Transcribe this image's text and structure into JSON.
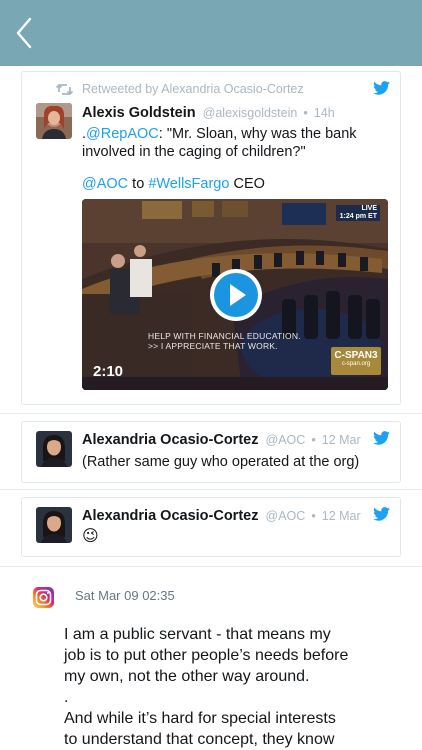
{
  "topbar": {
    "back_label": "back"
  },
  "tweet1": {
    "retweet_text": "Retweeted by Alexandria Ocasio-Cortez",
    "name": "Alexis Goldstein",
    "handle": "@alexisgoldstein",
    "time": "14h",
    "line1_prefix": ".",
    "line1_mention": "@RepAOC",
    "line1_rest": ": \"Mr. Sloan, why was the bank",
    "line2": "involved in the caging of children?\"",
    "line3_mention": "@AOC",
    "line3_mid": " to ",
    "line3_hashtag": "#WellsFargo",
    "line3_rest": " CEO",
    "video": {
      "duration": "2:10",
      "caption_line1": "HELP WITH FINANCIAL EDUCATION.",
      "caption_line2": ">> I APPRECIATE THAT WORK.",
      "live_line1": "LIVE",
      "live_line2": "1:24 pm ET",
      "network": "C-SPAN3",
      "network_url": "c-span.org"
    }
  },
  "tweet2": {
    "name": "Alexandria Ocasio-Cortez",
    "handle": "@AOC",
    "time": "12 Mar",
    "text": "(Rather same guy who operated at the org)"
  },
  "tweet3": {
    "name": "Alexandria Ocasio-Cortez",
    "handle": "@AOC",
    "time": "12 Mar",
    "text": "😉"
  },
  "instagram": {
    "date": "Sat Mar 09 02:35",
    "text_lines": [
      "I am a public servant - that means my",
      "job is to put other people’s needs before",
      "my own, not the other way around.",
      ".",
      "And while it’s hard for special interests",
      "to understand that concept, they know"
    ]
  },
  "icons": {
    "back": "chevron-left-icon",
    "retweet": "retweet-icon",
    "twitter": "twitter-bird-icon",
    "instagram": "instagram-icon",
    "play": "play-icon"
  },
  "colors": {
    "topbar": "#7aa7b4",
    "twitter_blue": "#1da1f2",
    "muted": "#aab8c2"
  },
  "separator": "•"
}
